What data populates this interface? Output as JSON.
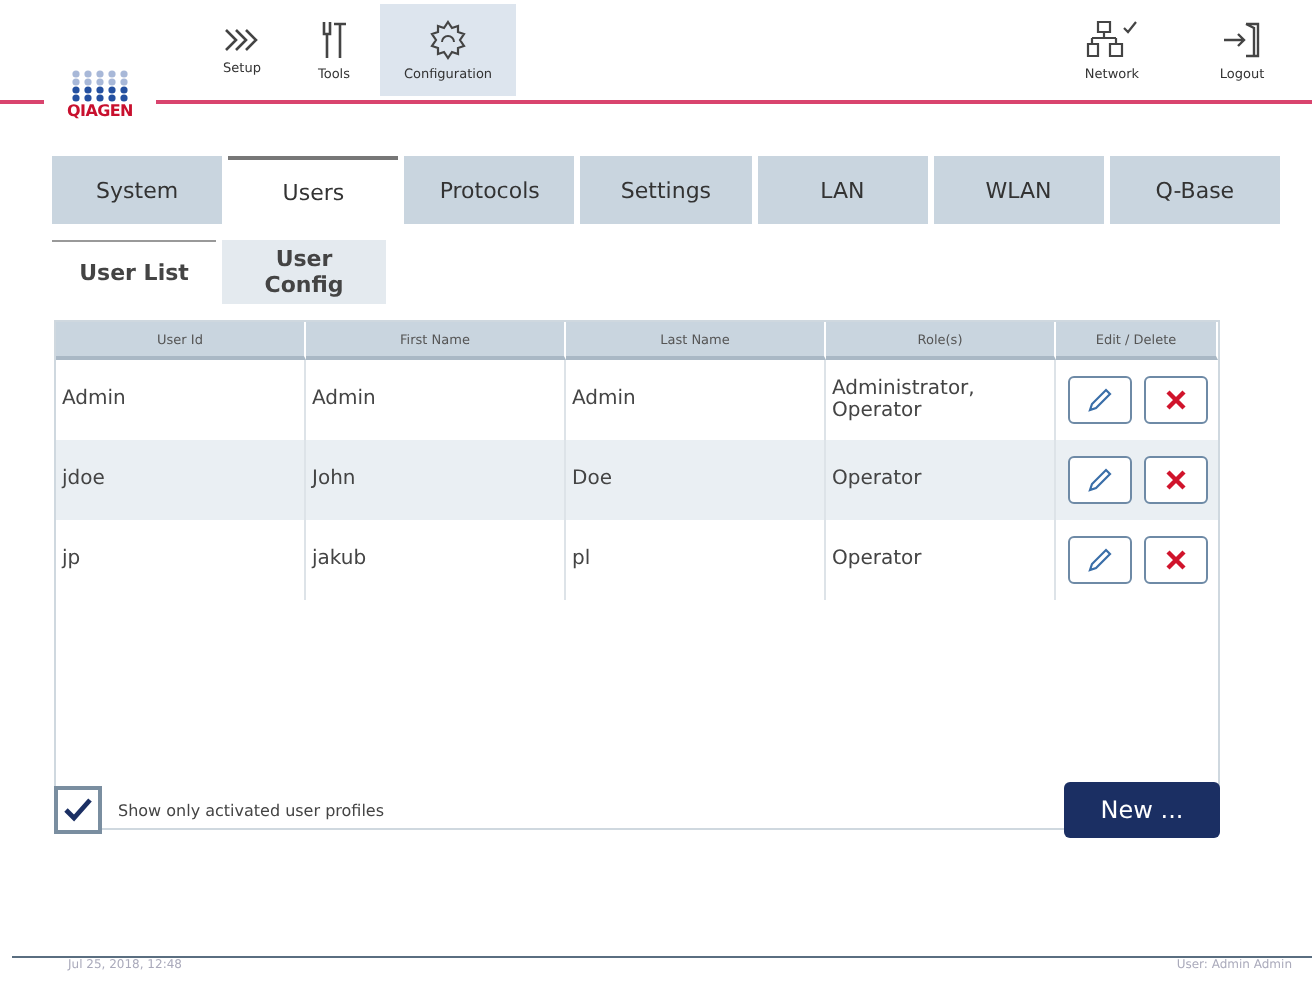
{
  "logo": {
    "text": "QIAGEN"
  },
  "toolbar": [
    {
      "label": "Setup",
      "kind": "setup",
      "selected": false
    },
    {
      "label": "Tools",
      "kind": "tools",
      "selected": false
    },
    {
      "label": "Configuration",
      "kind": "config",
      "selected": true
    }
  ],
  "toolbar_right": [
    {
      "label": "Network",
      "kind": "network"
    },
    {
      "label": "Logout",
      "kind": "logout"
    }
  ],
  "tabs": [
    {
      "label": "System",
      "selected": false
    },
    {
      "label": "Users",
      "selected": true
    },
    {
      "label": "Protocols",
      "selected": false
    },
    {
      "label": "Settings",
      "selected": false
    },
    {
      "label": "LAN",
      "selected": false
    },
    {
      "label": "WLAN",
      "selected": false
    },
    {
      "label": "Q-Base",
      "selected": false
    }
  ],
  "subtabs": [
    {
      "label": "User List",
      "selected": true
    },
    {
      "label": "User Config",
      "selected": false
    }
  ],
  "table": {
    "columns": [
      "User Id",
      "First Name",
      "Last Name",
      "Role(s)",
      "Edit / Delete"
    ],
    "rows": [
      {
        "cells": [
          "Admin",
          "Admin",
          "Admin",
          "Administrator, Operator"
        ]
      },
      {
        "cells": [
          "jdoe",
          "John",
          "Doe",
          "Operator"
        ]
      },
      {
        "cells": [
          "jp",
          "jakub",
          "pl",
          "Operator"
        ]
      }
    ]
  },
  "filter": {
    "label": "Show only activated user profiles",
    "checked": true
  },
  "new_button": "New ...",
  "status_bar": {
    "datetime": "Jul 25, 2018, 12:48",
    "user": "User: Admin Admin"
  }
}
